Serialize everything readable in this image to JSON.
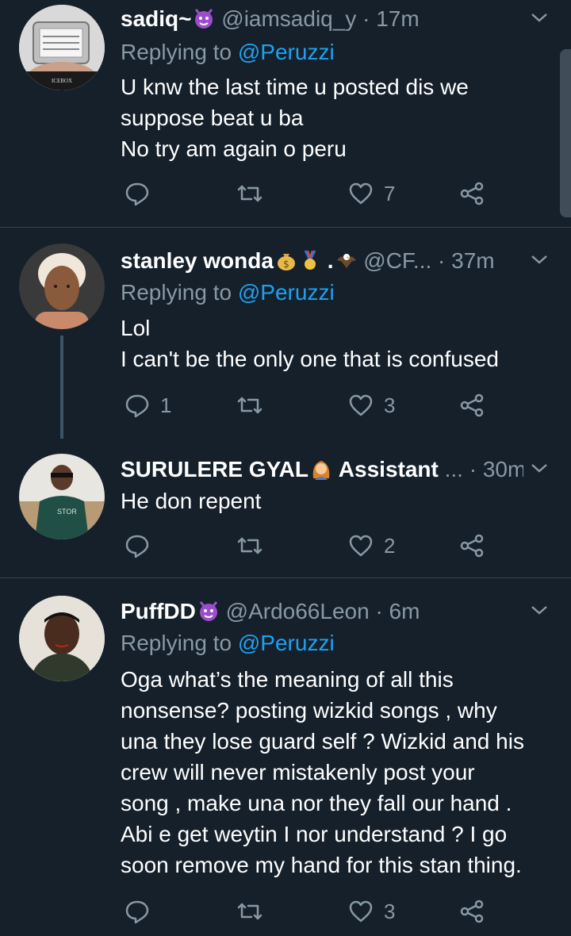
{
  "tweets": [
    {
      "name": "sadiq~",
      "emojis": [
        "devil-face"
      ],
      "handle": "@iamsadiq_y",
      "time": "· 17m",
      "replying_prefix": "Replying to ",
      "replying_to": "@Peruzzi",
      "lines": [
        "U knw the last time u posted dis we",
        "suppose beat u ba",
        "No try am again o peru"
      ],
      "replies": "",
      "retweets": "",
      "likes": "7",
      "avatar_text": "ICEBOX"
    },
    {
      "name": "stanley wonda",
      "emojis": [
        "money-bag",
        "medal",
        "dot",
        "eagle"
      ],
      "handle": "@CF...",
      "time": "· 37m",
      "replying_prefix": "Replying to ",
      "replying_to": "@Peruzzi",
      "lines": [
        "Lol",
        "I can't be the only one that is confused"
      ],
      "replies": "1",
      "retweets": "",
      "likes": "3"
    },
    {
      "name": "SURULERE GYAL",
      "emojis": [
        "woman"
      ],
      "name_suffix": "Assistant",
      "handle": "...",
      "time": "· 30m",
      "lines": [
        "He don repent"
      ],
      "replies": "",
      "retweets": "",
      "likes": "2"
    },
    {
      "name": "PuffDD",
      "emojis": [
        "devil-face"
      ],
      "handle": "@Ardo66Leon",
      "time": "· 6m",
      "replying_prefix": "Replying to ",
      "replying_to": "@Peruzzi",
      "lines": [
        "Oga what’s the meaning of all this",
        "nonsense? posting wizkid songs , why",
        "una they lose guard self ? Wizkid and his",
        "crew will  never mistakenly post your",
        "song  , make una nor they fall our hand .",
        "Abi e get weytin I nor understand ? I go",
        "soon remove my hand for this stan thing."
      ],
      "replies": "",
      "retweets": "",
      "likes": "3"
    }
  ],
  "colors": {
    "background": "#15202b",
    "muted": "#8899a6",
    "link": "#1da1f2",
    "divider": "#38444d"
  }
}
